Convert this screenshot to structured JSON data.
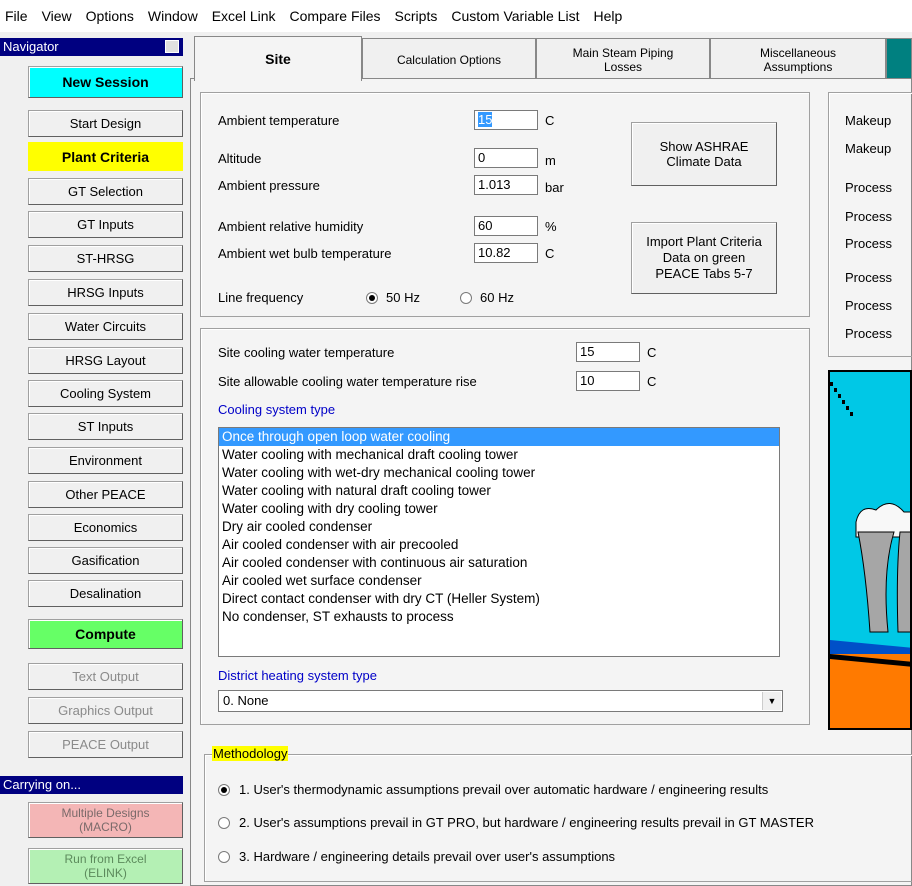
{
  "menu": [
    "File",
    "View",
    "Options",
    "Window",
    "Excel Link",
    "Compare Files",
    "Scripts",
    "Custom Variable List",
    "Help"
  ],
  "navigator": {
    "title": "Navigator",
    "new_session": "New Session",
    "items": [
      "Start Design",
      "Plant Criteria",
      "GT Selection",
      "GT Inputs",
      "ST-HRSG",
      "HRSG Inputs",
      "Water Circuits",
      "HRSG Layout",
      "Cooling System",
      "ST Inputs",
      "Environment",
      "Other PEACE",
      "Economics",
      "Gasification",
      "Desalination"
    ],
    "compute": "Compute",
    "outputs": [
      "Text Output",
      "Graphics Output",
      "PEACE Output"
    ],
    "carrying_on_title": "Carrying on...",
    "multiple_designs": "Multiple Designs\n(MACRO)",
    "run_from_excel": "Run from Excel\n(ELINK)",
    "colors": {
      "cyan": "#00ffff",
      "yellow": "#ffff00",
      "green": "#66ff66",
      "pink": "#f4b6b6",
      "lightgreen": "#b4f0b4",
      "header": "#000080"
    }
  },
  "tabs": [
    "Site",
    "Calculation Options",
    "Main Steam Piping\nLosses",
    "Miscellaneous\nAssumptions"
  ],
  "site": {
    "ambient_temperature": {
      "label": "Ambient temperature",
      "value": "15",
      "unit": "C"
    },
    "altitude": {
      "label": "Altitude",
      "value": "0",
      "unit": "m"
    },
    "ambient_pressure": {
      "label": "Ambient pressure",
      "value": "1.013",
      "unit": "bar"
    },
    "relative_humidity": {
      "label": "Ambient relative humidity",
      "value": "60",
      "unit": "%"
    },
    "wet_bulb": {
      "label": "Ambient wet bulb temperature",
      "value": "10.82",
      "unit": "C"
    },
    "line_frequency": {
      "label": "Line frequency",
      "options": [
        "50 Hz",
        "60 Hz"
      ],
      "selected": "50 Hz"
    },
    "ashrae_button": "Show ASHRAE\nClimate Data",
    "import_button": "Import Plant Criteria\nData on green\nPEACE Tabs 5-7"
  },
  "right_labels": [
    "Makeup",
    "Makeup",
    "Process",
    "Process",
    "Process",
    "Process",
    "Process",
    "Process"
  ],
  "cooling": {
    "water_temp": {
      "label": "Site cooling water temperature",
      "value": "15",
      "unit": "C"
    },
    "temp_rise": {
      "label": "Site allowable cooling water temperature rise",
      "value": "10",
      "unit": "C"
    },
    "system_type_label": "Cooling system type",
    "options": [
      "Once through open loop water cooling",
      "Water cooling with mechanical draft cooling tower",
      "Water cooling with wet-dry mechanical cooling tower",
      "Water cooling with natural draft cooling tower",
      "Water cooling with dry cooling tower",
      "Dry air cooled condenser",
      "Air cooled condenser with air precooled",
      "Air cooled condenser with continuous air saturation",
      "Air cooled wet surface condenser",
      "Direct contact condenser with dry CT (Heller System)",
      "No condenser, ST exhausts to process"
    ],
    "selected_index": 0,
    "district_label": "District heating system type",
    "district_value": "0. None"
  },
  "methodology": {
    "title": "Methodology",
    "options": [
      "1. User's thermodynamic assumptions prevail over automatic hardware / engineering results",
      "2. User's assumptions prevail in GT PRO, but hardware / engineering results prevail in GT MASTER",
      "3. Hardware / engineering details prevail over user's assumptions"
    ],
    "selected_index": 0
  }
}
